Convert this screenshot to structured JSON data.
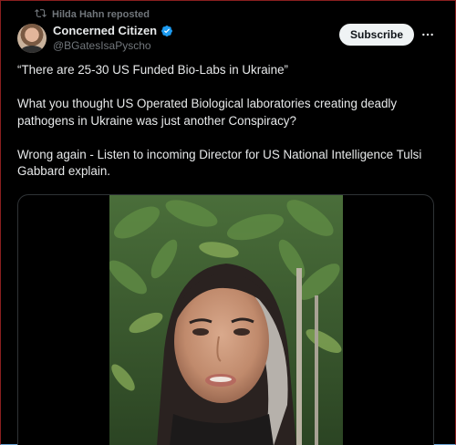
{
  "repost": {
    "icon": "repost-icon",
    "text": "Hilda Hahn reposted"
  },
  "author": {
    "name": "Concerned Citizen",
    "handle": "@BGatesIsaPyscho",
    "verified_icon": "verified-badge-icon",
    "verified_color": "#1d9bf0"
  },
  "actions": {
    "subscribe_label": "Subscribe",
    "more_icon": "more-options-icon"
  },
  "tweet": {
    "line1": "“There are 25-30 US Funded Bio-Labs in Ukraine”",
    "line2": "What you thought US Operated Biological laboratories creating deadly pathogens in Ukraine was just another Conspiracy?",
    "line3": "Wrong again - Listen to incoming Director for US National Intelligence Tulsi Gabbard explain."
  },
  "colors": {
    "background": "#000000",
    "text": "#e7e9ea",
    "muted": "#71767b",
    "accent": "#1d9bf0"
  }
}
